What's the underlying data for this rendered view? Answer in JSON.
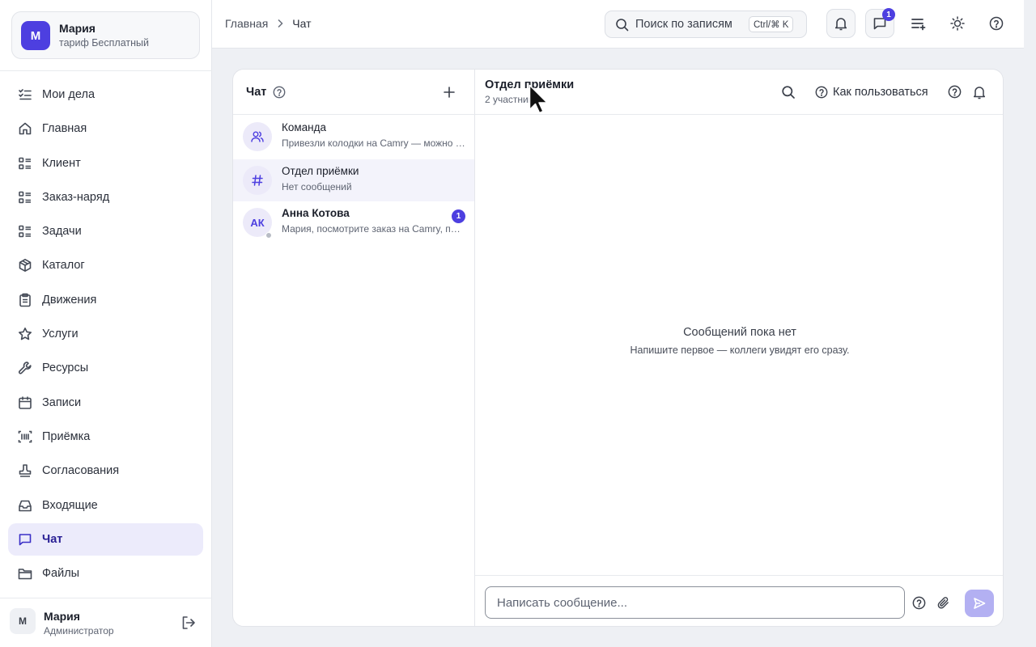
{
  "account": {
    "initial": "М",
    "name": "Мария",
    "plan": "тариф Бесплатный"
  },
  "nav": {
    "items": [
      {
        "label": "Мои дела",
        "icon": "checklist-icon"
      },
      {
        "label": "Главная",
        "icon": "home-icon"
      },
      {
        "label": "Клиент",
        "icon": "list-icon"
      },
      {
        "label": "Заказ-наряд",
        "icon": "list-icon"
      },
      {
        "label": "Задачи",
        "icon": "list-icon"
      },
      {
        "label": "Каталог",
        "icon": "box-icon"
      },
      {
        "label": "Движения",
        "icon": "clipboard-icon"
      },
      {
        "label": "Услуги",
        "icon": "star-icon"
      },
      {
        "label": "Ресурсы",
        "icon": "wrench-icon"
      },
      {
        "label": "Записи",
        "icon": "calendar-icon"
      },
      {
        "label": "Приёмка",
        "icon": "barcode-icon"
      },
      {
        "label": "Согласования",
        "icon": "stamp-icon"
      },
      {
        "label": "Входящие",
        "icon": "inbox-icon"
      },
      {
        "label": "Чат",
        "icon": "chat-icon",
        "active": true
      },
      {
        "label": "Файлы",
        "icon": "folder-icon"
      }
    ]
  },
  "user": {
    "initial": "М",
    "name": "Мария",
    "role": "Администратор"
  },
  "breadcrumb": {
    "home": "Главная",
    "current": "Чат"
  },
  "search": {
    "placeholder": "Поиск по записям",
    "shortcut": "Ctrl/⌘ K"
  },
  "topbar": {
    "messages_badge": "1"
  },
  "chat_list": {
    "title": "Чат",
    "conversations": [
      {
        "name": "Команда",
        "preview": "Привезли колодки на Camry — можно ставить",
        "avatar_icon": "users-icon"
      },
      {
        "name": "Отдел приёмки",
        "preview": "Нет сообщений",
        "avatar_icon": "hash-icon",
        "active": true
      },
      {
        "name": "Анна Котова",
        "preview": "Мария, посмотрите заказ на Camry, пожалуйста",
        "avatar_text": "АК",
        "unread": "1"
      }
    ]
  },
  "chat": {
    "title": "Отдел приёмки",
    "subtitle": "2 участника",
    "howto_label": "Как пользоваться",
    "empty_title": "Сообщений пока нет",
    "empty_subtitle": "Напишите первое — коллеги увидят его сразу.",
    "input_placeholder": "Написать сообщение..."
  },
  "colors": {
    "accent": "#4d3fe0",
    "active_bg": "#ecebfb",
    "send_disabled": "#b3b0f2"
  }
}
